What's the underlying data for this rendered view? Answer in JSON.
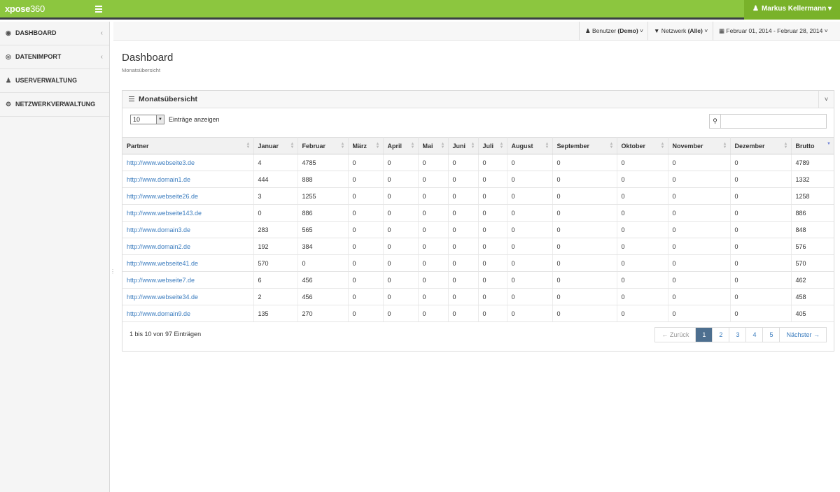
{
  "brand": {
    "name": "xpose",
    "num": "360"
  },
  "user": {
    "icon": "user-icon",
    "name": "Markus Kellermann",
    "caret": "▾"
  },
  "sidebar": {
    "items": [
      {
        "label": "Dashboard",
        "icon": "tachometer-icon",
        "glyph": "◉",
        "chevron": "‹"
      },
      {
        "label": "Datenimport",
        "icon": "import-icon",
        "glyph": "◎",
        "chevron": "‹"
      },
      {
        "label": "Userverwaltung",
        "icon": "user-icon",
        "glyph": "♟",
        "chevron": ""
      },
      {
        "label": "Netzwerkverwaltung",
        "icon": "cogs-icon",
        "glyph": "⚙",
        "chevron": ""
      }
    ]
  },
  "filters": {
    "benutzer": {
      "prefix": "Benutzer ",
      "value": "(Demo)"
    },
    "netzwerk": {
      "prefix": "Netzwerk ",
      "value": "(Alle)"
    },
    "date_range": "Februar 01, 2014 - Februar 28, 2014"
  },
  "page": {
    "title": "Dashboard",
    "subtitle": "Monatsübersicht"
  },
  "widget": {
    "title": "Monatsübersicht",
    "length_value": "10",
    "length_label": "Einträge anzeigen",
    "search_value": "",
    "columns": [
      "Partner",
      "Januar",
      "Februar",
      "März",
      "April",
      "Mai",
      "Juni",
      "Juli",
      "August",
      "September",
      "Oktober",
      "November",
      "Dezember",
      "Brutto"
    ],
    "rows": [
      [
        "http://www.webseite3.de",
        "4",
        "4785",
        "0",
        "0",
        "0",
        "0",
        "0",
        "0",
        "0",
        "0",
        "0",
        "0",
        "4789"
      ],
      [
        "http://www.domain1.de",
        "444",
        "888",
        "0",
        "0",
        "0",
        "0",
        "0",
        "0",
        "0",
        "0",
        "0",
        "0",
        "1332"
      ],
      [
        "http://www.webseite26.de",
        "3",
        "1255",
        "0",
        "0",
        "0",
        "0",
        "0",
        "0",
        "0",
        "0",
        "0",
        "0",
        "1258"
      ],
      [
        "http://www.webseite143.de",
        "0",
        "886",
        "0",
        "0",
        "0",
        "0",
        "0",
        "0",
        "0",
        "0",
        "0",
        "0",
        "886"
      ],
      [
        "http://www.domain3.de",
        "283",
        "565",
        "0",
        "0",
        "0",
        "0",
        "0",
        "0",
        "0",
        "0",
        "0",
        "0",
        "848"
      ],
      [
        "http://www.domain2.de",
        "192",
        "384",
        "0",
        "0",
        "0",
        "0",
        "0",
        "0",
        "0",
        "0",
        "0",
        "0",
        "576"
      ],
      [
        "http://www.webseite41.de",
        "570",
        "0",
        "0",
        "0",
        "0",
        "0",
        "0",
        "0",
        "0",
        "0",
        "0",
        "0",
        "570"
      ],
      [
        "http://www.webseite7.de",
        "6",
        "456",
        "0",
        "0",
        "0",
        "0",
        "0",
        "0",
        "0",
        "0",
        "0",
        "0",
        "462"
      ],
      [
        "http://www.webseite34.de",
        "2",
        "456",
        "0",
        "0",
        "0",
        "0",
        "0",
        "0",
        "0",
        "0",
        "0",
        "0",
        "458"
      ],
      [
        "http://www.domain9.de",
        "135",
        "270",
        "0",
        "0",
        "0",
        "0",
        "0",
        "0",
        "0",
        "0",
        "0",
        "0",
        "405"
      ]
    ],
    "info": "1 bis 10 von 97 Einträgen",
    "pager": {
      "prev": "← Zurück",
      "pages": [
        "1",
        "2",
        "3",
        "4",
        "5"
      ],
      "next": "Nächster →",
      "active": "1"
    }
  }
}
